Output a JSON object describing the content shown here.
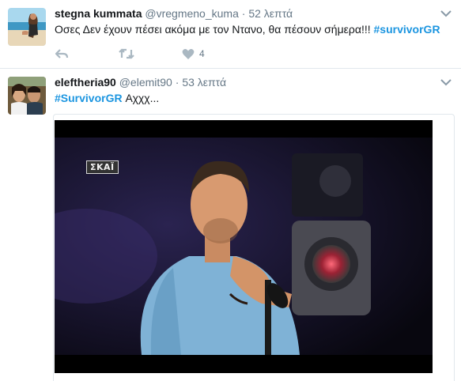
{
  "colors": {
    "link": "#1b95e0",
    "muted": "#657786",
    "border": "#e1e8ed",
    "text": "#14171a"
  },
  "tweets": [
    {
      "name": "stegna kummata",
      "handle": "@vregmeno_kuma",
      "separator": "·",
      "time": "52 λεπτά",
      "text": "Οσες Δεν έχουν πέσει ακόμα με τον Ντανο, θα πέσουν σήμερα!!! ",
      "hashtag": "#survivorGR",
      "likes": "4",
      "icons": [
        "reply-icon",
        "retweet-icon",
        "like-icon",
        "caret-down-icon"
      ]
    },
    {
      "name": "eleftheria90",
      "handle": "@elemit90",
      "separator": "·",
      "time": "53 λεπτά",
      "hashtag": "#SurvivorGR",
      "text": " Αχχχ...",
      "media": {
        "logo_text": "ΣΚΑΪ"
      },
      "icons": [
        "caret-down-icon"
      ]
    }
  ]
}
